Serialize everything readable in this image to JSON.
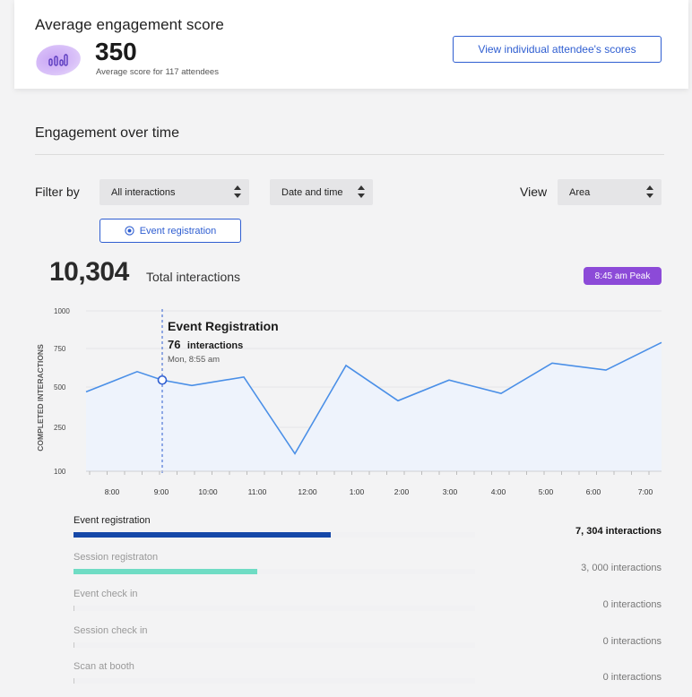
{
  "summary": {
    "title": "Average engagement score",
    "value": "350",
    "subtitle": "Average score for 117 attendees",
    "button_label": "View individual attendee's scores"
  },
  "section": {
    "title": "Engagement over time"
  },
  "filters": {
    "filter_label": "Filter by",
    "interaction_select": "All interactions",
    "time_select": "Date and time",
    "view_label": "View",
    "view_select": "Area",
    "active_chip": "Event registration"
  },
  "totals": {
    "value": "10,304",
    "label": "Total interactions",
    "peak_badge": "8:45 am Peak"
  },
  "colors": {
    "accent": "#2f5ed1",
    "peak": "#8c4ad8",
    "line": "#4a8fe7",
    "area": "#eef3fc",
    "bar_event": "#1548a8",
    "bar_session": "#6fdcc4"
  },
  "chart_data": {
    "type": "area",
    "ylabel": "COMPLETED INTERACTIONS",
    "yticks": [
      1000,
      750,
      500,
      250,
      100
    ],
    "xticks": [
      "8:00",
      "9:00",
      "10:00",
      "11:00",
      "12:00",
      "1:00",
      "2:00",
      "3:00",
      "4:00",
      "5:00",
      "6:00",
      "7:00"
    ],
    "x": [
      "7:30",
      "8:30",
      "8:55",
      "9:30",
      "10:30",
      "11:30",
      "12:30",
      "1:30",
      "2:30",
      "3:30",
      "4:30",
      "5:30",
      "6:30"
    ],
    "values": [
      470,
      600,
      545,
      510,
      565,
      160,
      640,
      415,
      545,
      460,
      655,
      610,
      790
    ],
    "tooltip": {
      "title": "Event Registration",
      "count": "76",
      "count_unit": "interactions",
      "time": "Mon, 8:55 am",
      "point_index": 2
    }
  },
  "breakdown": [
    {
      "label": "Event registration",
      "value": "7, 304  interactions",
      "fraction": 0.64,
      "color": "#1548a8",
      "active": true
    },
    {
      "label": "Session registraton",
      "value": "3, 000 interactions",
      "fraction": 0.458,
      "color": "#6fdcc4",
      "active": false
    },
    {
      "label": "Event check in",
      "value": "0 interactions",
      "fraction": 0,
      "color": "#cccccc",
      "active": false
    },
    {
      "label": "Session check in",
      "value": "0 interactions",
      "fraction": 0,
      "color": "#cccccc",
      "active": false
    },
    {
      "label": "Scan at booth",
      "value": "0 interactions",
      "fraction": 0,
      "color": "#cccccc",
      "active": false
    }
  ]
}
